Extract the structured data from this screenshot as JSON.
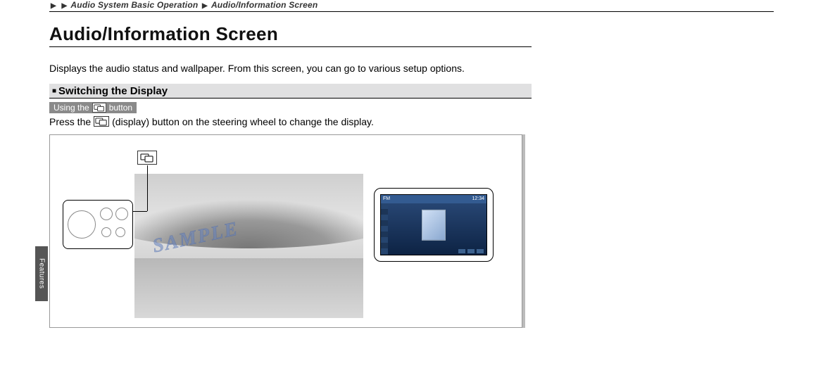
{
  "breadcrumb": {
    "sep": "▶",
    "item1": "Audio System Basic Operation",
    "item2": "Audio/Information Screen"
  },
  "title": "Audio/Information Screen",
  "intro": "Displays the audio status and wallpaper. From this screen, you can go to various  setup options.",
  "subhead": "Switching the Display",
  "tag": {
    "prefix": "Using the",
    "suffix": "button"
  },
  "instruction": {
    "prefix": "Press the",
    "suffix": "(display) button on the steering wheel to change the display."
  },
  "figure": {
    "watermark": "SAMPLE",
    "inset_time": "12:34",
    "inset_band": "FM"
  },
  "side_tab": "Features"
}
